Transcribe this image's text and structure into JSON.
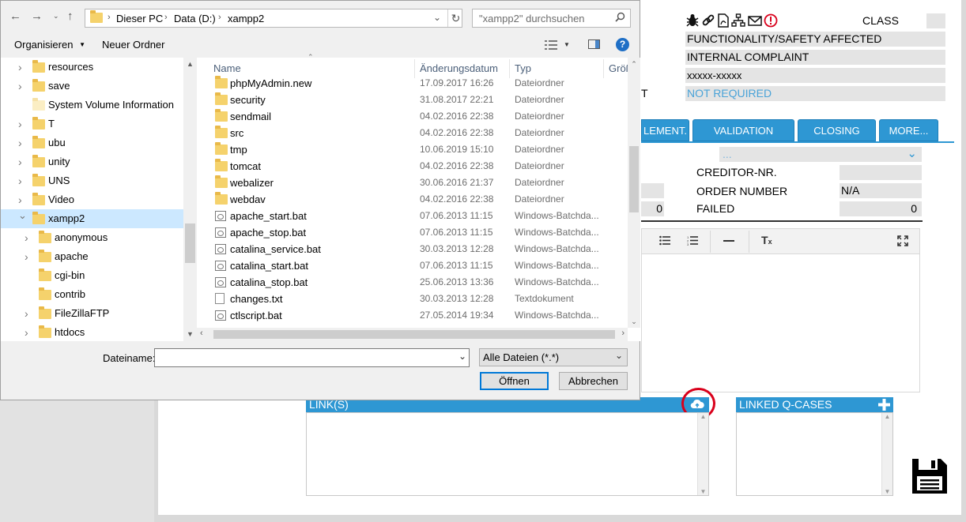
{
  "app": {
    "header_fields": [
      "FUNCTIONALITY/SAFETY AFFECTED",
      "INTERNAL COMPLAINT",
      "xxxxx-xxxxx",
      "NOT REQUIRED"
    ],
    "class_label": "CLASS",
    "cut_label": "T",
    "tabs": [
      "LEMENT.",
      "VALIDATION",
      "CLOSING",
      "MORE..."
    ],
    "dropdown_value": "...",
    "creditor_label": "CREDITOR-NR.",
    "order_label": "ORDER NUMBER",
    "order_value": "N/A",
    "failed_label": "FAILED",
    "failed_value": "0",
    "left_value": "0",
    "links_title": "LINK(S)",
    "linked_title": "LINKED Q-CASES",
    "accent_color": "#2e97d3",
    "highlight_color": "#d9001b"
  },
  "dialog": {
    "breadcrumb": [
      "Dieser PC",
      "Data (D:)",
      "xampp2"
    ],
    "search_placeholder": "\"xampp2\" durchsuchen",
    "toolbar": {
      "organize": "Organisieren",
      "new_folder": "Neuer Ordner"
    },
    "tree": [
      {
        "label": "resources",
        "chev": true,
        "indent": 0,
        "selected": false,
        "pale": false
      },
      {
        "label": "save",
        "chev": true,
        "indent": 0,
        "selected": false,
        "pale": false
      },
      {
        "label": "System Volume Information",
        "chev": false,
        "indent": 0,
        "selected": false,
        "pale": true
      },
      {
        "label": "T",
        "chev": true,
        "indent": 0,
        "selected": false,
        "pale": false
      },
      {
        "label": "ubu",
        "chev": true,
        "indent": 0,
        "selected": false,
        "pale": false
      },
      {
        "label": "unity",
        "chev": true,
        "indent": 0,
        "selected": false,
        "pale": false
      },
      {
        "label": "UNS",
        "chev": true,
        "indent": 0,
        "selected": false,
        "pale": false
      },
      {
        "label": "Video",
        "chev": true,
        "indent": 0,
        "selected": false,
        "pale": false
      },
      {
        "label": "xampp2",
        "chev": "open",
        "indent": 0,
        "selected": true,
        "pale": false
      },
      {
        "label": "anonymous",
        "chev": true,
        "indent": 1,
        "selected": false,
        "pale": false
      },
      {
        "label": "apache",
        "chev": true,
        "indent": 1,
        "selected": false,
        "pale": false
      },
      {
        "label": "cgi-bin",
        "chev": false,
        "indent": 1,
        "selected": false,
        "pale": false
      },
      {
        "label": "contrib",
        "chev": false,
        "indent": 1,
        "selected": false,
        "pale": false
      },
      {
        "label": "FileZillaFTP",
        "chev": true,
        "indent": 1,
        "selected": false,
        "pale": false
      },
      {
        "label": "htdocs",
        "chev": true,
        "indent": 1,
        "selected": false,
        "pale": false
      }
    ],
    "columns": {
      "name": "Name",
      "date": "Änderungsdatum",
      "type": "Typ",
      "size": "Größ"
    },
    "files": [
      {
        "name": "phpMyAdmin.new",
        "date": "17.09.2017 16:26",
        "type": "Dateiordner",
        "icon": "folder"
      },
      {
        "name": "security",
        "date": "31.08.2017 22:21",
        "type": "Dateiordner",
        "icon": "folder"
      },
      {
        "name": "sendmail",
        "date": "04.02.2016 22:38",
        "type": "Dateiordner",
        "icon": "folder"
      },
      {
        "name": "src",
        "date": "04.02.2016 22:38",
        "type": "Dateiordner",
        "icon": "folder"
      },
      {
        "name": "tmp",
        "date": "10.06.2019 15:10",
        "type": "Dateiordner",
        "icon": "folder"
      },
      {
        "name": "tomcat",
        "date": "04.02.2016 22:38",
        "type": "Dateiordner",
        "icon": "folder"
      },
      {
        "name": "webalizer",
        "date": "30.06.2016 21:37",
        "type": "Dateiordner",
        "icon": "folder"
      },
      {
        "name": "webdav",
        "date": "04.02.2016 22:38",
        "type": "Dateiordner",
        "icon": "folder"
      },
      {
        "name": "apache_start.bat",
        "date": "07.06.2013 11:15",
        "type": "Windows-Batchda...",
        "icon": "bat"
      },
      {
        "name": "apache_stop.bat",
        "date": "07.06.2013 11:15",
        "type": "Windows-Batchda...",
        "icon": "bat"
      },
      {
        "name": "catalina_service.bat",
        "date": "30.03.2013 12:28",
        "type": "Windows-Batchda...",
        "icon": "bat"
      },
      {
        "name": "catalina_start.bat",
        "date": "07.06.2013 11:15",
        "type": "Windows-Batchda...",
        "icon": "bat"
      },
      {
        "name": "catalina_stop.bat",
        "date": "25.06.2013 13:36",
        "type": "Windows-Batchda...",
        "icon": "bat"
      },
      {
        "name": "changes.txt",
        "date": "30.03.2013 12:28",
        "type": "Textdokument",
        "icon": "txt"
      },
      {
        "name": "ctlscript.bat",
        "date": "27.05.2014 19:34",
        "type": "Windows-Batchda...",
        "icon": "bat"
      }
    ],
    "filename_label": "Dateiname:",
    "filename_value": "",
    "filter_value": "Alle Dateien (*.*)",
    "open_button": "Öffnen",
    "cancel_button": "Abbrechen"
  }
}
